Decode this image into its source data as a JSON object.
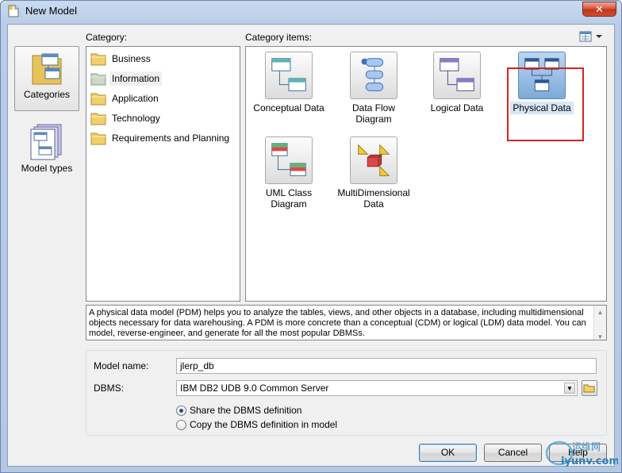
{
  "window": {
    "title": "New Model",
    "close_glyph": "✕"
  },
  "nav": {
    "items": [
      {
        "label": "Categories",
        "icon": "categories-folder-icon",
        "selected": true
      },
      {
        "label": "Model types",
        "icon": "model-types-stack-icon",
        "selected": false
      }
    ]
  },
  "labels": {
    "category": "Category:",
    "category_items": "Category items:"
  },
  "categories": [
    {
      "label": "Business",
      "selected": false
    },
    {
      "label": "Information",
      "selected": true
    },
    {
      "label": "Application",
      "selected": false
    },
    {
      "label": "Technology",
      "selected": false
    },
    {
      "label": "Requirements and Planning",
      "selected": false
    }
  ],
  "category_items": [
    {
      "label": "Conceptual Data",
      "icon": "conceptual-data-icon",
      "selected": false
    },
    {
      "label": "Data Flow Diagram",
      "icon": "data-flow-diagram-icon",
      "selected": false
    },
    {
      "label": "Logical Data",
      "icon": "logical-data-icon",
      "selected": false
    },
    {
      "label": "Physical Data",
      "icon": "physical-data-icon",
      "selected": true
    },
    {
      "label": "UML Class Diagram",
      "icon": "uml-class-diagram-icon",
      "selected": false
    },
    {
      "label": "MultiDimensional Data",
      "icon": "multidimensional-data-icon",
      "selected": false
    }
  ],
  "description": "A physical data model (PDM) helps you to analyze the tables, views, and other objects in a database, including multidimensional objects necessary for data warehousing. A PDM is more concrete than a conceptual (CDM) or logical (LDM) data model. You can model, reverse-engineer, and generate for all the most popular DBMSs.",
  "form": {
    "model_name_label": "Model name:",
    "model_name_value": "jlerp_db",
    "dbms_label": "DBMS:",
    "dbms_value": "IBM DB2 UDB 9.0 Common Server",
    "radio_share": "Share the DBMS definition",
    "radio_copy": "Copy the DBMS definition in model",
    "selected_radio": "share"
  },
  "buttons": {
    "ok": "OK",
    "cancel": "Cancel",
    "help": "Help"
  },
  "watermark": {
    "line1": "运维网",
    "line2": "iyunv.com"
  },
  "colors": {
    "highlight": "#d9231c",
    "selection": "#d7e6f7"
  }
}
